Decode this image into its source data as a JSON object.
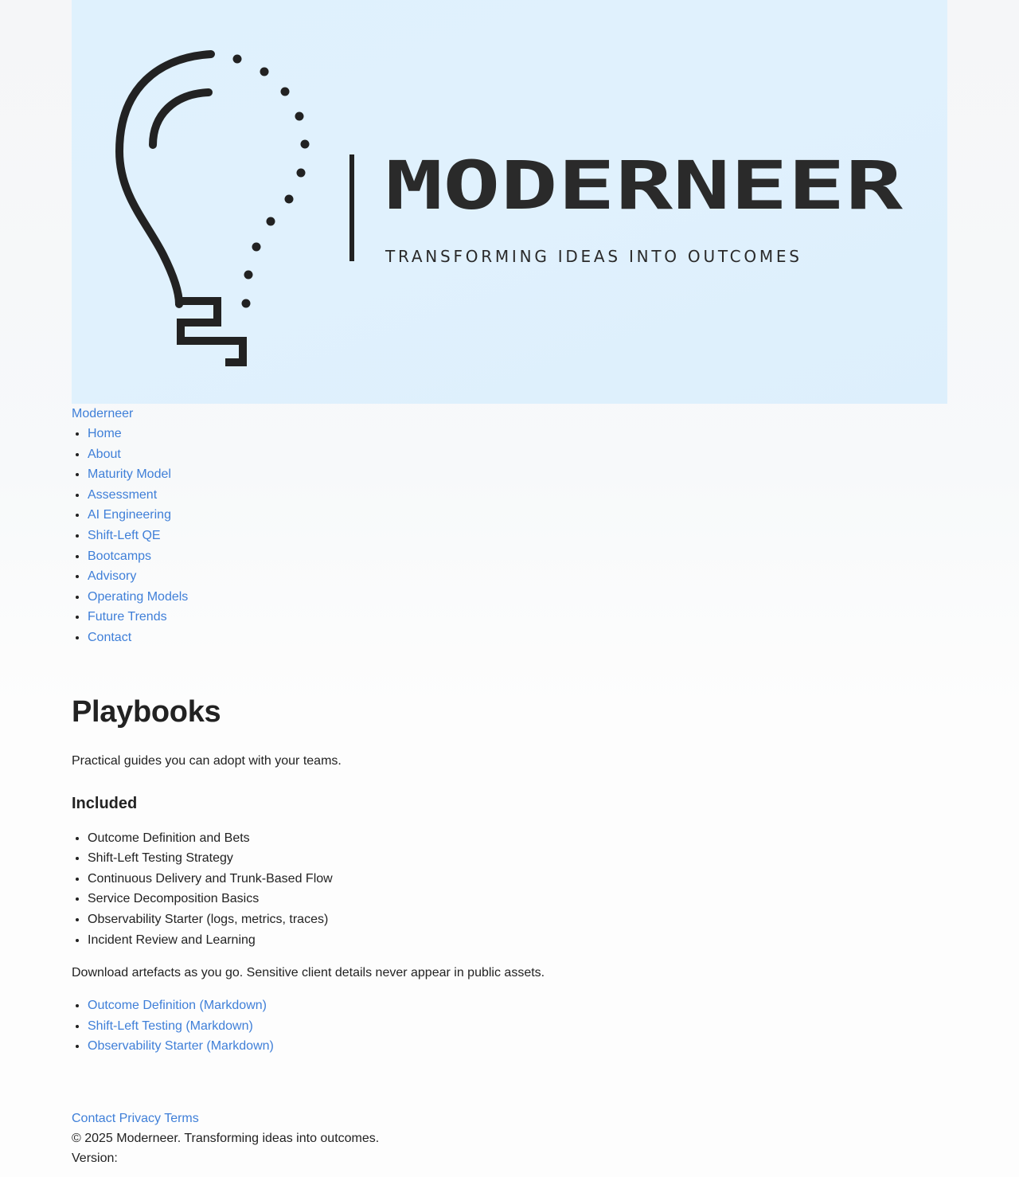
{
  "hero": {
    "logo_alt": "Moderneer logo",
    "brand": "MODERNEER",
    "tagline": "TRANSFORMING IDEAS INTO OUTCOMES",
    "icon": "lightbulb-head-icon"
  },
  "site": {
    "name": "Moderneer"
  },
  "nav": {
    "items": [
      {
        "label": "Home"
      },
      {
        "label": "About"
      },
      {
        "label": "Maturity Model"
      },
      {
        "label": "Assessment"
      },
      {
        "label": "AI Engineering"
      },
      {
        "label": "Shift-Left QE"
      },
      {
        "label": "Bootcamps"
      },
      {
        "label": "Advisory"
      },
      {
        "label": "Operating Models"
      },
      {
        "label": "Future Trends"
      },
      {
        "label": "Contact"
      }
    ]
  },
  "main": {
    "title": "Playbooks",
    "intro": "Practical guides you can adopt with your teams.",
    "included_heading": "Included",
    "included": [
      "Outcome Definition and Bets",
      "Shift-Left Testing Strategy",
      "Continuous Delivery and Trunk-Based Flow",
      "Service Decomposition Basics",
      "Observability Starter (logs, metrics, traces)",
      "Incident Review and Learning"
    ],
    "download_note": "Download artefacts as you go. Sensitive client details never appear in public assets.",
    "downloads": [
      "Outcome Definition (Markdown)",
      "Shift-Left Testing (Markdown)",
      "Observability Starter (Markdown)"
    ]
  },
  "footer": {
    "links": [
      "Contact",
      "Privacy",
      "Terms"
    ],
    "copyright": "© 2025 Moderneer. Transforming ideas into outcomes.",
    "version_label": "Version:"
  },
  "colors": {
    "link": "#3f7fd8",
    "hero_bg": "#dff1fd",
    "logo_ink": "#222222"
  }
}
